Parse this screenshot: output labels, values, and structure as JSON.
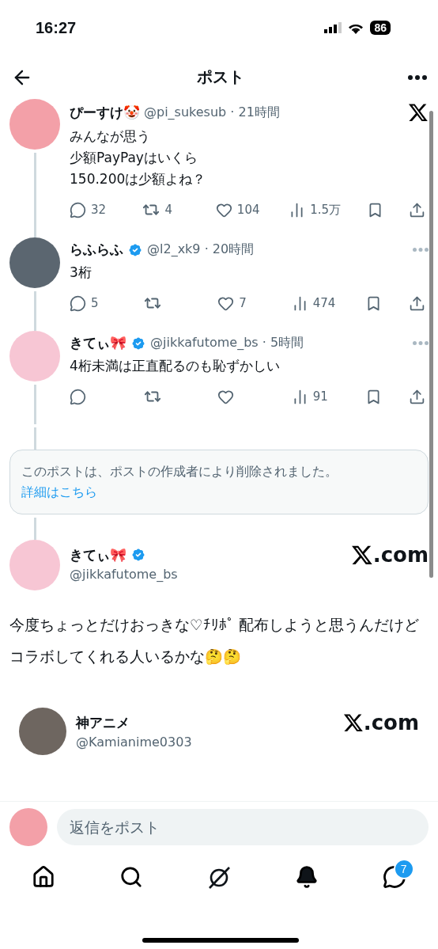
{
  "status_bar": {
    "time": "16:27",
    "battery": "86"
  },
  "header": {
    "title": "ポスト"
  },
  "thread": [
    {
      "kind": "original",
      "name": "ぴーすけ🤡",
      "verified": false,
      "meta": "@pi_sukesub · 21時間",
      "body": [
        "みんなが思う",
        "少額PayPayはいくら",
        "150.200は少額よね？"
      ],
      "replies": "32",
      "reposts": "4",
      "likes": "104",
      "views": "1.5万"
    },
    {
      "kind": "reply",
      "name": "らふらふ",
      "verified": true,
      "meta": "@l2_xk9 · 20時間",
      "body": [
        "3桁"
      ],
      "replies": "5",
      "likes": "7",
      "views": "474"
    },
    {
      "kind": "reply",
      "name": "きてぃ🎀",
      "verified": true,
      "meta": "@jikkafutome_bs · 5時間",
      "body": [
        "4桁未満は正直配るのも恥ずかしい"
      ],
      "views": "91"
    }
  ],
  "deleted_notice": {
    "text": "このポストは、ポストの作成者により削除されました。",
    "link": "詳細はこちら"
  },
  "main_post": {
    "name": "きてぃ🎀",
    "verified": true,
    "handle": "@jikkafutome_bs",
    "source": ".com",
    "body": "今度ちょっとだけおっきな♡ﾁﾘﾎﾟ 配布しようと思うんだけどコラボしてくれる人いるかな🤔🤔"
  },
  "quoted": {
    "name": "神アニメ",
    "handle": "@Kamianime0303",
    "source": ".com"
  },
  "reply_bar": {
    "placeholder": "返信をポスト"
  },
  "nav": [
    {
      "kind": "home",
      "selected": false
    },
    {
      "kind": "search",
      "selected": false
    },
    {
      "kind": "grok",
      "selected": false
    },
    {
      "kind": "notifications",
      "selected": true
    },
    {
      "kind": "messages",
      "selected": false,
      "badge": "7"
    }
  ]
}
